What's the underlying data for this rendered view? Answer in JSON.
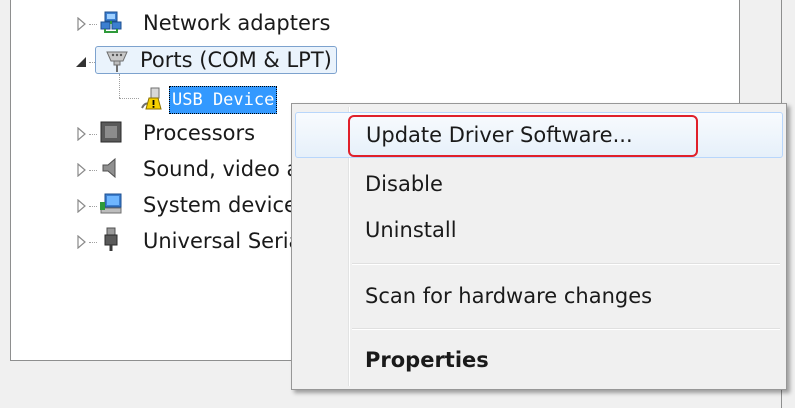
{
  "tree": {
    "items": [
      {
        "label": "Network adapters",
        "icon": "network-adapter-icon",
        "expanded": false
      },
      {
        "label": "Ports (COM & LPT)",
        "icon": "port-icon",
        "expanded": true
      },
      {
        "label": "USB Device",
        "icon": "usb-device-warning-icon",
        "selected": true
      },
      {
        "label": "Processors",
        "icon": "processor-icon",
        "expanded": false
      },
      {
        "label": "Sound, video a",
        "icon": "speaker-icon",
        "expanded": false
      },
      {
        "label": "System device",
        "icon": "system-device-icon",
        "expanded": false
      },
      {
        "label": "Universal Seria",
        "icon": "usb-plug-icon",
        "expanded": false
      }
    ]
  },
  "context_menu": {
    "items": [
      {
        "label": "Update Driver Software...",
        "highlighted": true
      },
      {
        "label": "Disable"
      },
      {
        "label": "Uninstall"
      },
      {
        "label": "Scan for hardware changes"
      },
      {
        "label": "Properties",
        "bold": true
      }
    ]
  },
  "colors": {
    "highlight_box": "#e0202a",
    "selection": "#3399ff",
    "warning": "#f5d000"
  }
}
